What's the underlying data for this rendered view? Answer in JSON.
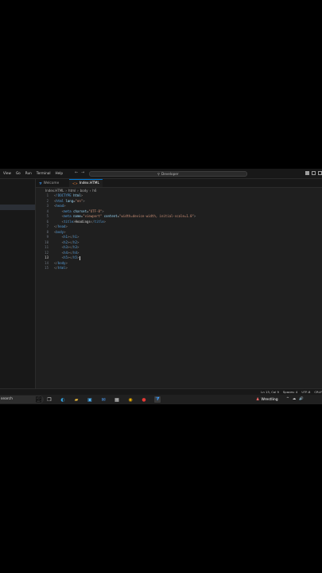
{
  "menu": [
    "View",
    "Go",
    "Run",
    "Terminal",
    "Help"
  ],
  "nav": {
    "back": "←",
    "forward": "→"
  },
  "command_center": {
    "icon": "search-icon",
    "label": "Developer"
  },
  "tabs": [
    {
      "label": "Welcome",
      "icon": "vscode-icon",
      "active": false
    },
    {
      "label": "Index.HTML",
      "icon": "html-file-icon",
      "active": true,
      "modified": true
    }
  ],
  "breadcrumb": [
    "Index.HTML",
    "›",
    "html",
    "›",
    "body",
    "›",
    "h6"
  ],
  "code_lines": [
    {
      "n": "1",
      "parts": [
        [
          "t",
          "<"
        ],
        [
          "tag",
          "!DOCTYPE"
        ],
        [
          "txt",
          " "
        ],
        [
          "attr",
          "html"
        ],
        [
          "t",
          ">"
        ]
      ]
    },
    {
      "n": "2",
      "parts": [
        [
          "t",
          "<"
        ],
        [
          "tag",
          "html"
        ],
        [
          "txt",
          " "
        ],
        [
          "attr",
          "lang"
        ],
        [
          "txt",
          "="
        ],
        [
          "str",
          "\"en\""
        ],
        [
          "t",
          ">"
        ]
      ]
    },
    {
      "n": "3",
      "parts": [
        [
          "t",
          "<"
        ],
        [
          "tag",
          "head"
        ],
        [
          "t",
          ">"
        ]
      ]
    },
    {
      "n": "4",
      "parts": [
        [
          "txt",
          "    "
        ],
        [
          "t",
          "<"
        ],
        [
          "tag",
          "meta"
        ],
        [
          "txt",
          " "
        ],
        [
          "attr",
          "charset"
        ],
        [
          "txt",
          "="
        ],
        [
          "str",
          "\"UTF-8\""
        ],
        [
          "t",
          ">"
        ]
      ]
    },
    {
      "n": "5",
      "parts": [
        [
          "txt",
          "    "
        ],
        [
          "t",
          "<"
        ],
        [
          "tag",
          "meta"
        ],
        [
          "txt",
          " "
        ],
        [
          "attr",
          "name"
        ],
        [
          "txt",
          "="
        ],
        [
          "str",
          "\"viewport\""
        ],
        [
          "txt",
          " "
        ],
        [
          "attr",
          "content"
        ],
        [
          "txt",
          "="
        ],
        [
          "str",
          "\"width=device-width, initial-scale=1.0\""
        ],
        [
          "t",
          ">"
        ]
      ]
    },
    {
      "n": "6",
      "parts": [
        [
          "txt",
          "    "
        ],
        [
          "t",
          "<"
        ],
        [
          "tag",
          "title"
        ],
        [
          "t",
          ">"
        ],
        [
          "txt",
          "Headings"
        ],
        [
          "t",
          "</"
        ],
        [
          "tag",
          "title"
        ],
        [
          "t",
          ">"
        ]
      ]
    },
    {
      "n": "7",
      "parts": [
        [
          "t",
          "</"
        ],
        [
          "tag",
          "head"
        ],
        [
          "t",
          ">"
        ]
      ]
    },
    {
      "n": "8",
      "parts": [
        [
          "t",
          "<"
        ],
        [
          "tag",
          "body"
        ],
        [
          "t",
          ">"
        ]
      ]
    },
    {
      "n": "9",
      "parts": [
        [
          "txt",
          "    "
        ],
        [
          "t",
          "<"
        ],
        [
          "tag",
          "h1"
        ],
        [
          "t",
          "></"
        ],
        [
          "tag",
          "h1"
        ],
        [
          "t",
          ">"
        ]
      ]
    },
    {
      "n": "10",
      "parts": [
        [
          "txt",
          "    "
        ],
        [
          "t",
          "<"
        ],
        [
          "tag",
          "h2"
        ],
        [
          "t",
          "></"
        ],
        [
          "tag",
          "h2"
        ],
        [
          "t",
          ">"
        ]
      ]
    },
    {
      "n": "11",
      "parts": [
        [
          "txt",
          "    "
        ],
        [
          "t",
          "<"
        ],
        [
          "tag",
          "h3"
        ],
        [
          "t",
          "></"
        ],
        [
          "tag",
          "h3"
        ],
        [
          "t",
          ">"
        ]
      ]
    },
    {
      "n": "12",
      "parts": [
        [
          "txt",
          "    "
        ],
        [
          "t",
          "<"
        ],
        [
          "tag",
          "h4"
        ],
        [
          "t",
          "></"
        ],
        [
          "tag",
          "h4"
        ],
        [
          "t",
          ">"
        ]
      ]
    },
    {
      "n": "13",
      "parts": [
        [
          "txt",
          "    "
        ],
        [
          "t",
          "<"
        ],
        [
          "tag",
          "h5"
        ],
        [
          "t",
          "></"
        ],
        [
          "tag",
          "h5"
        ],
        [
          "t",
          ">"
        ]
      ]
    },
    {
      "n": "14",
      "parts": [
        [
          "t",
          "</"
        ],
        [
          "tag",
          "body"
        ],
        [
          "t",
          ">"
        ]
      ]
    },
    {
      "n": "15",
      "parts": [
        [
          "t",
          "</"
        ],
        [
          "tag",
          "html"
        ],
        [
          "t",
          ">"
        ]
      ]
    }
  ],
  "current_line": "13",
  "status": [
    "Ln 13, Col 9",
    "Spaces: 4",
    "UTF-8",
    "CRLF"
  ],
  "taskbar": {
    "search_label": "search",
    "apps": [
      "task-view-icon",
      "edge-icon",
      "file-explorer-icon",
      "store-icon",
      "mail-icon",
      "calculator-icon",
      "chrome-icon",
      "media-icon",
      "vscode-icon"
    ],
    "weather_label": "Wrestling",
    "tray": [
      "^",
      "☁",
      "🔊"
    ]
  },
  "colors": {
    "accent": "#0078d4",
    "tag": "#569cd6",
    "attr": "#9cdcfe",
    "string": "#ce9178"
  }
}
